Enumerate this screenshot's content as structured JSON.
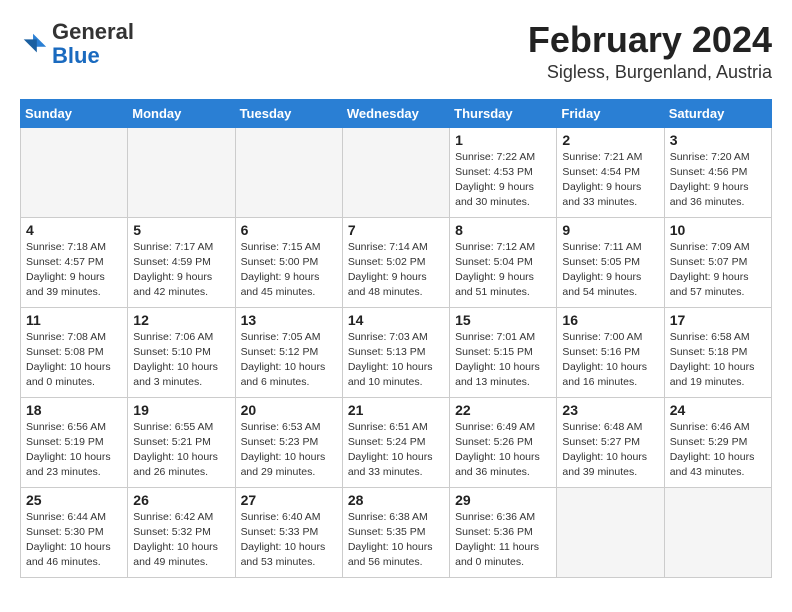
{
  "header": {
    "logo_general": "General",
    "logo_blue": "Blue",
    "month_title": "February 2024",
    "location": "Sigless, Burgenland, Austria"
  },
  "weekdays": [
    "Sunday",
    "Monday",
    "Tuesday",
    "Wednesday",
    "Thursday",
    "Friday",
    "Saturday"
  ],
  "weeks": [
    [
      {
        "day": "",
        "info": ""
      },
      {
        "day": "",
        "info": ""
      },
      {
        "day": "",
        "info": ""
      },
      {
        "day": "",
        "info": ""
      },
      {
        "day": "1",
        "info": "Sunrise: 7:22 AM\nSunset: 4:53 PM\nDaylight: 9 hours\nand 30 minutes."
      },
      {
        "day": "2",
        "info": "Sunrise: 7:21 AM\nSunset: 4:54 PM\nDaylight: 9 hours\nand 33 minutes."
      },
      {
        "day": "3",
        "info": "Sunrise: 7:20 AM\nSunset: 4:56 PM\nDaylight: 9 hours\nand 36 minutes."
      }
    ],
    [
      {
        "day": "4",
        "info": "Sunrise: 7:18 AM\nSunset: 4:57 PM\nDaylight: 9 hours\nand 39 minutes."
      },
      {
        "day": "5",
        "info": "Sunrise: 7:17 AM\nSunset: 4:59 PM\nDaylight: 9 hours\nand 42 minutes."
      },
      {
        "day": "6",
        "info": "Sunrise: 7:15 AM\nSunset: 5:00 PM\nDaylight: 9 hours\nand 45 minutes."
      },
      {
        "day": "7",
        "info": "Sunrise: 7:14 AM\nSunset: 5:02 PM\nDaylight: 9 hours\nand 48 minutes."
      },
      {
        "day": "8",
        "info": "Sunrise: 7:12 AM\nSunset: 5:04 PM\nDaylight: 9 hours\nand 51 minutes."
      },
      {
        "day": "9",
        "info": "Sunrise: 7:11 AM\nSunset: 5:05 PM\nDaylight: 9 hours\nand 54 minutes."
      },
      {
        "day": "10",
        "info": "Sunrise: 7:09 AM\nSunset: 5:07 PM\nDaylight: 9 hours\nand 57 minutes."
      }
    ],
    [
      {
        "day": "11",
        "info": "Sunrise: 7:08 AM\nSunset: 5:08 PM\nDaylight: 10 hours\nand 0 minutes."
      },
      {
        "day": "12",
        "info": "Sunrise: 7:06 AM\nSunset: 5:10 PM\nDaylight: 10 hours\nand 3 minutes."
      },
      {
        "day": "13",
        "info": "Sunrise: 7:05 AM\nSunset: 5:12 PM\nDaylight: 10 hours\nand 6 minutes."
      },
      {
        "day": "14",
        "info": "Sunrise: 7:03 AM\nSunset: 5:13 PM\nDaylight: 10 hours\nand 10 minutes."
      },
      {
        "day": "15",
        "info": "Sunrise: 7:01 AM\nSunset: 5:15 PM\nDaylight: 10 hours\nand 13 minutes."
      },
      {
        "day": "16",
        "info": "Sunrise: 7:00 AM\nSunset: 5:16 PM\nDaylight: 10 hours\nand 16 minutes."
      },
      {
        "day": "17",
        "info": "Sunrise: 6:58 AM\nSunset: 5:18 PM\nDaylight: 10 hours\nand 19 minutes."
      }
    ],
    [
      {
        "day": "18",
        "info": "Sunrise: 6:56 AM\nSunset: 5:19 PM\nDaylight: 10 hours\nand 23 minutes."
      },
      {
        "day": "19",
        "info": "Sunrise: 6:55 AM\nSunset: 5:21 PM\nDaylight: 10 hours\nand 26 minutes."
      },
      {
        "day": "20",
        "info": "Sunrise: 6:53 AM\nSunset: 5:23 PM\nDaylight: 10 hours\nand 29 minutes."
      },
      {
        "day": "21",
        "info": "Sunrise: 6:51 AM\nSunset: 5:24 PM\nDaylight: 10 hours\nand 33 minutes."
      },
      {
        "day": "22",
        "info": "Sunrise: 6:49 AM\nSunset: 5:26 PM\nDaylight: 10 hours\nand 36 minutes."
      },
      {
        "day": "23",
        "info": "Sunrise: 6:48 AM\nSunset: 5:27 PM\nDaylight: 10 hours\nand 39 minutes."
      },
      {
        "day": "24",
        "info": "Sunrise: 6:46 AM\nSunset: 5:29 PM\nDaylight: 10 hours\nand 43 minutes."
      }
    ],
    [
      {
        "day": "25",
        "info": "Sunrise: 6:44 AM\nSunset: 5:30 PM\nDaylight: 10 hours\nand 46 minutes."
      },
      {
        "day": "26",
        "info": "Sunrise: 6:42 AM\nSunset: 5:32 PM\nDaylight: 10 hours\nand 49 minutes."
      },
      {
        "day": "27",
        "info": "Sunrise: 6:40 AM\nSunset: 5:33 PM\nDaylight: 10 hours\nand 53 minutes."
      },
      {
        "day": "28",
        "info": "Sunrise: 6:38 AM\nSunset: 5:35 PM\nDaylight: 10 hours\nand 56 minutes."
      },
      {
        "day": "29",
        "info": "Sunrise: 6:36 AM\nSunset: 5:36 PM\nDaylight: 11 hours\nand 0 minutes."
      },
      {
        "day": "",
        "info": ""
      },
      {
        "day": "",
        "info": ""
      }
    ]
  ]
}
